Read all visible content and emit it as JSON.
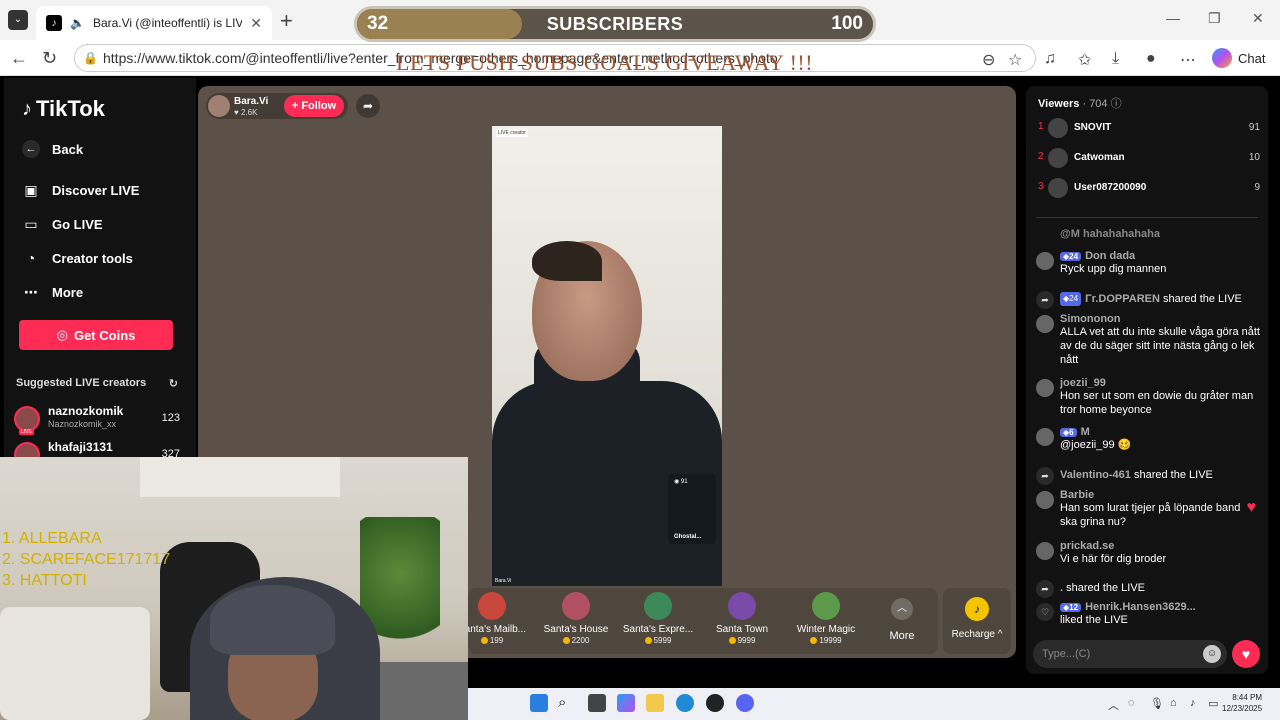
{
  "browser": {
    "tab_title": "Bara.Vi (@inteoffentli) is LIVE",
    "url": "https://www.tiktok.com/@inteoffentli/live?enter_from_merge=others_homepage&enter_method=others_photo",
    "chat_label": "Chat"
  },
  "overlay": {
    "subs_current": "32",
    "subs_label": "SUBSCRIBERS",
    "subs_goal": "100",
    "subs_progress": 0.32,
    "giveaway_text": "LETS PUSH SUBS GOALS GIVEAWAY !!!",
    "ranking": [
      "1.   ALLEBARA",
      "2.   SCAREFACE171717",
      "3.   HATTOTI"
    ]
  },
  "sidebar": {
    "brand": "TikTok",
    "back_label": "Back",
    "nav": [
      "Discover LIVE",
      "Go LIVE",
      "Creator tools",
      "More"
    ],
    "get_coins": "Get Coins",
    "suggested_title": "Suggested LIVE creators",
    "live_tag": "LIVE",
    "creators": [
      {
        "name": "naznozkomik",
        "handle": "Naznozkomik_xx",
        "count": "123"
      },
      {
        "name": "khafaji3131",
        "handle": "",
        "count": "327"
      }
    ]
  },
  "stream": {
    "host_name": "Bara.Vi",
    "host_likes": "2.6K",
    "follow_label": "+ Follow",
    "video_tag": "LIVE creator",
    "video_bottom_tag": "Bara.Vi",
    "mini_viewers": "91",
    "mini_name": "Ghostal...",
    "gifts": [
      {
        "name": "Santa's Mailb...",
        "price": "199",
        "color": "#c8463c"
      },
      {
        "name": "Santa's House",
        "price": "2200",
        "color": "#b05060"
      },
      {
        "name": "Santa's Expre...",
        "price": "5999",
        "color": "#3c8a5a"
      },
      {
        "name": "Santa Town",
        "price": "9999",
        "color": "#7a4aa8"
      },
      {
        "name": "Winter Magic",
        "price": "19999",
        "color": "#5a9a4a"
      }
    ],
    "more_label": "More",
    "recharge_label": "Recharge"
  },
  "viewers": {
    "title": "Viewers",
    "count": "704",
    "top": [
      {
        "rank": "1",
        "name": "SNOVIT",
        "score": "91"
      },
      {
        "rank": "2",
        "name": "Catwoman",
        "score": "10"
      },
      {
        "rank": "3",
        "name": "User087200090",
        "score": "9"
      }
    ]
  },
  "chat": {
    "messages": [
      {
        "name": "@M hahahahahaha",
        "badge": "",
        "text": ""
      },
      {
        "name": "Don dada",
        "badge": "24",
        "text": "Ryck upp dig mannen"
      },
      {
        "name": "Γr.DOPPAREN",
        "badge": "24",
        "text": "shared the LIVE",
        "type": "share"
      },
      {
        "name": "Simononon",
        "badge": "",
        "text": "ALLA vet att du inte skulle våga göra nått av de du säger sitt inte nästa gång o lek nått"
      },
      {
        "name": "joezii_99",
        "badge": "",
        "text": "Hon ser ut som en dowie du gråter man tror home beyonce"
      },
      {
        "name": "M",
        "badge": "6",
        "text": "@joezii_99 🥴"
      },
      {
        "name": "Valentino-461",
        "badge": "",
        "text": "shared the LIVE",
        "type": "share"
      },
      {
        "name": "Barbie",
        "badge": "",
        "text": "Han som lurat tjejer på löpande band ska grina nu?"
      },
      {
        "name": "prickad.se",
        "badge": "",
        "text": "Vi e här för dig broder"
      },
      {
        "name": ".",
        "badge": "",
        "text": "shared the LIVE",
        "type": "share"
      },
      {
        "name": "Henrik.Hansen3629...",
        "badge": "12",
        "text": "liked the LIVE",
        "type": "like"
      }
    ],
    "input_placeholder": "Type...(C)"
  },
  "taskbar": {
    "time": "8:44 PM",
    "date": "12/23/2025"
  }
}
